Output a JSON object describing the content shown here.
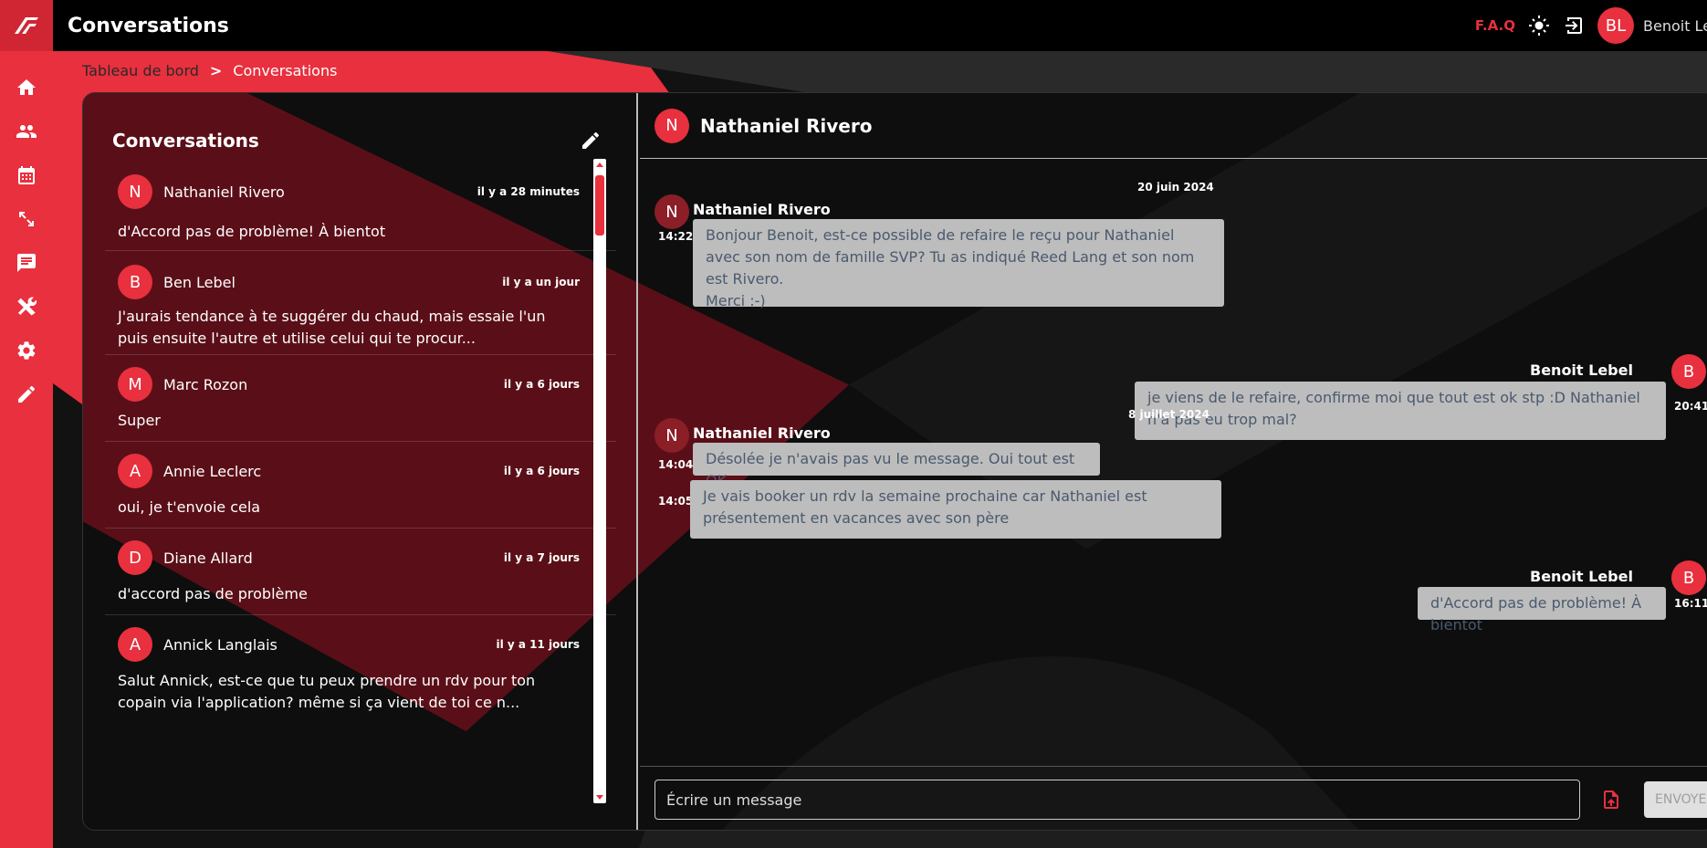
{
  "colors": {
    "accent": "#e8303e",
    "accent_dark": "#8b1e27",
    "background": "#121212",
    "bubble": "#bdbdbd",
    "bubble_text": "#4a5a6e"
  },
  "topbar": {
    "title": "Conversations",
    "faq": "F.A.Q",
    "user_initials": "BL",
    "user_name": "Benoit Le"
  },
  "sidebar": {
    "items": [
      {
        "icon": "home-icon"
      },
      {
        "icon": "people-icon"
      },
      {
        "icon": "calendar-icon"
      },
      {
        "icon": "expand-arrows-icon"
      },
      {
        "icon": "chat-icon"
      },
      {
        "icon": "tools-icon"
      },
      {
        "icon": "settings-icon"
      },
      {
        "icon": "pencil-icon"
      }
    ]
  },
  "breadcrumb": {
    "parent": "Tableau de bord",
    "separator": ">",
    "current": "Conversations"
  },
  "conversations": {
    "title": "Conversations",
    "items": [
      {
        "initial": "N",
        "name": "Nathaniel Rivero",
        "time": "il y a 28 minutes",
        "preview": "d'Accord pas de problème! À bientot"
      },
      {
        "initial": "B",
        "name": "Ben Lebel",
        "time": "il y a un jour",
        "preview": "J'aurais tendance à te suggérer du chaud, mais essaie l'un puis ensuite l'autre et utilise celui qui te procur..."
      },
      {
        "initial": "M",
        "name": "Marc Rozon",
        "time": "il y a 6 jours",
        "preview": "Super"
      },
      {
        "initial": "A",
        "name": "Annie Leclerc",
        "time": "il y a 6 jours",
        "preview": "oui, je t'envoie cela"
      },
      {
        "initial": "D",
        "name": "Diane Allard",
        "time": "il y a 7 jours",
        "preview": "d'accord pas de problème"
      },
      {
        "initial": "A",
        "name": "Annick Langlais",
        "time": "il y a 11 jours",
        "preview": "Salut Annick, est-ce que tu peux prendre un rdv pour ton copain via l'application? même si ça vient de toi ce n..."
      }
    ]
  },
  "chat": {
    "contact_initial": "N",
    "contact_name": "Nathaniel Rivero",
    "dates": [
      "20 juin 2024",
      "8 juillet 2024"
    ],
    "messages": [
      {
        "sender": "Nathaniel Rivero",
        "initial": "N",
        "time": "14:22",
        "text": "Bonjour Benoit, est-ce possible de refaire le reçu pour Nathaniel avec son nom de famille SVP? Tu as indiqué Reed Lang et son nom est Rivero.\nMerci :-)"
      },
      {
        "sender": "Benoit Lebel",
        "initial": "B",
        "time": "20:41",
        "text": "je viens de le refaire, confirme moi que tout est ok stp :D Nathaniel n'a pas eu trop mal?"
      },
      {
        "sender": "Nathaniel Rivero",
        "initial": "N",
        "time": "14:04",
        "text": "Désolée je n'avais pas vu le message. Oui tout est OK."
      },
      {
        "sender": "",
        "initial": "",
        "time": "14:05",
        "text": "Je vais booker un rdv la semaine prochaine car Nathaniel est présentement en vacances avec son père"
      },
      {
        "sender": "Benoit Lebel",
        "initial": "B",
        "time": "16:11",
        "text": "d'Accord pas de problème! À bientot"
      }
    ]
  },
  "composer": {
    "placeholder": "Écrire un message",
    "send_label": "ENVOYER"
  }
}
